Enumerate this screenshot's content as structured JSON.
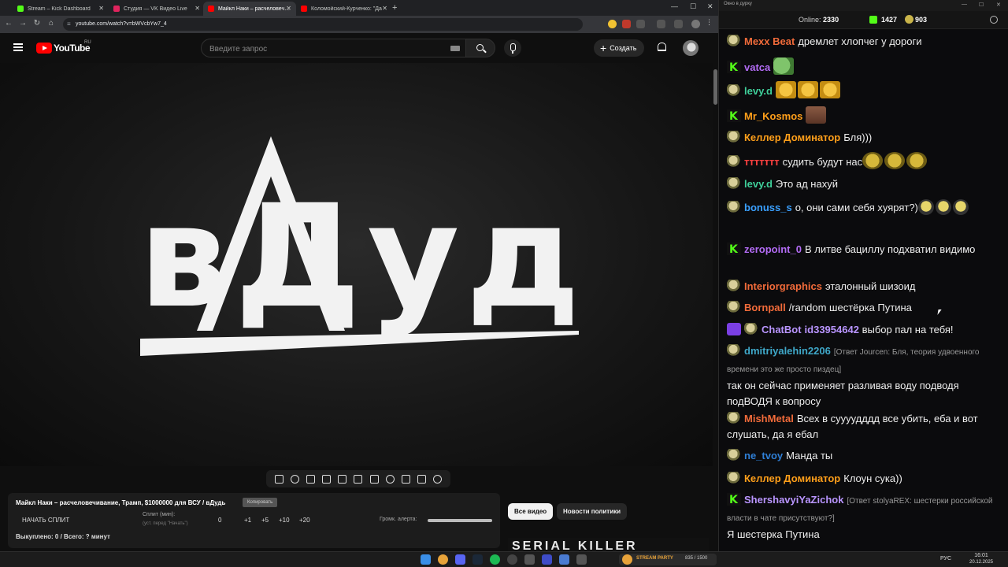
{
  "browser": {
    "tabs": [
      {
        "label": "Stream – Kick Dashboard",
        "color": "#53fc18"
      },
      {
        "label": "Студия — VK Видео Live",
        "color": "#e0245e"
      },
      {
        "label": "Майкл Наки – расчеловечивание",
        "color": "#ff0000"
      },
      {
        "label": "Коломойский-Курченко: \"Да",
        "color": "#ff0000"
      }
    ],
    "active_tab": 2,
    "url": "youtube.com/watch?v=bWVcbYw7_4"
  },
  "youtube": {
    "wordmark": "YouTube",
    "region": "RU",
    "search_placeholder": "Введите запрос",
    "create_label": "Создать",
    "video_logo_text": "вДудь",
    "chips": [
      "Все видео",
      "Новости политики"
    ],
    "thumbnail_text": "SERIAL KILLER"
  },
  "split": {
    "title": "Майкл Наки – расчеловечивание, Трамп, $1000000 для ВСУ / вДудь",
    "copy_label": "Копировать",
    "start_label": "НАЧАТЬ СПЛИТ",
    "split_label": "Сплит (мин):",
    "split_hint": "(уст. перед \"Начать\")",
    "split_value": "0",
    "steps": [
      "+1",
      "+5",
      "+10",
      "+20"
    ],
    "alert_label": "Громк. алерта:",
    "alert_volume": 1.0,
    "bought": "Выкуплено: 0 / Всего: ? минут"
  },
  "chat": {
    "window_title": "Окно в дурку",
    "online_label": "Online:",
    "online_count": "2330",
    "kick_count": "1427",
    "other_count": "903",
    "messages": [
      {
        "badge": "pepe",
        "user": "Mexx Beat",
        "color": "#f26b3a",
        "text": "дремлет хлопчег у дороги"
      },
      {
        "badge": "kick",
        "user": "vatca",
        "color": "#b36cf5",
        "text": "",
        "emotes": [
          "frog"
        ]
      },
      {
        "badge": "pepe",
        "user": "levy.d",
        "color": "#3fcf9a",
        "text": "",
        "emotes": [
          "laugh",
          "laugh",
          "laugh"
        ]
      },
      {
        "badge": "kick",
        "user": "Mr_Kosmos",
        "color": "#ff9f1a",
        "text": "",
        "emotes": [
          "face"
        ]
      },
      {
        "badge": "pepe",
        "user": "Келлер Доминатор",
        "color": "#ff9f1a",
        "text": "Бля)))"
      },
      {
        "badge": "pepe",
        "user": "ттттттт",
        "color": "#ff4040",
        "text": "судить будут нас",
        "emotes": [
          "gold",
          "gold",
          "gold"
        ]
      },
      {
        "badge": "pepe",
        "user": "levy.d",
        "color": "#3fcf9a",
        "text": "Это ад нахуй"
      },
      {
        "badge": "pepe",
        "user": "bonuss_s",
        "color": "#3aa0ff",
        "text": "о, они сами себя хуярят?)",
        "emotes": [
          "mini",
          "mini",
          "mini"
        ]
      },
      {
        "badge": "kick",
        "user": "zeropoint_0",
        "color": "#b36cf5",
        "text": "В литве бациллу подхватил видимо"
      },
      {
        "badge": "pepe",
        "user": "Interiorgraphics",
        "color": "#f26b3a",
        "text": "эталонный шизоид"
      },
      {
        "badge": "pepe",
        "user": "Bornpall",
        "color": "#f26b3a",
        "text": "/random шестёрка Путина"
      },
      {
        "badge": "bot",
        "user": "ChatBot",
        "color": "#b995ff",
        "text": "id33954642 выбор пал на тебя!",
        "mention": "id33954642"
      },
      {
        "badge": "pepe",
        "user": "dmitriyalehin2206",
        "color": "#3fa8c9",
        "reply": "[Ответ Jourcen: Бля, теория удвоенного времени это же просто пиздец]",
        "text": "так он сейчас применяет разливая воду подводя подВОДЯ к вопросу"
      },
      {
        "badge": "pepe",
        "user": "MishMetal",
        "color": "#f26b3a",
        "text": "Всех в суууудддд все убить, еба и вот слушать, да я ебал"
      },
      {
        "badge": "pepe",
        "user": "ne_tvoy",
        "color": "#2f7fd6",
        "text": "Манда ты"
      },
      {
        "badge": "pepe",
        "user": "Келлер Доминатор",
        "color": "#ff9f1a",
        "text": "Клоун сука))"
      },
      {
        "badge": "kick",
        "user": "ShershavyiYaZichok",
        "color": "#b995ff",
        "reply": "[Ответ stolyaREX: шестерки российской власти в чате присутствуют?]",
        "text": "Я шестерка Путина"
      }
    ]
  },
  "taskbar": {
    "widget_text": "STREAM PARTY",
    "widget_count": "835 / 1500",
    "lang": "РУС",
    "time": "16:01",
    "date": "20.12.2025"
  }
}
